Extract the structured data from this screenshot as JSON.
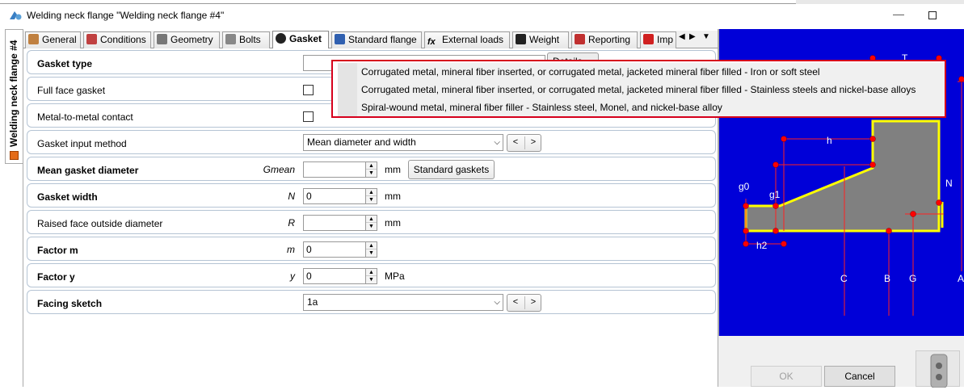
{
  "window": {
    "title": "Welding neck flange \"Welding neck flange #4\"",
    "minimize_glyph": "—"
  },
  "side_tab": {
    "label": "Welding neck flange #4"
  },
  "tabs": [
    {
      "label": "General",
      "icon": "general-icon",
      "color": "#c08040"
    },
    {
      "label": "Conditions",
      "icon": "conditions-icon",
      "color": "#c04040"
    },
    {
      "label": "Geometry",
      "icon": "geometry-icon",
      "color": "#555555"
    },
    {
      "label": "Bolts",
      "icon": "bolts-icon",
      "color": "#666666"
    },
    {
      "label": "Gasket",
      "icon": "gasket-icon",
      "color": "#222222"
    },
    {
      "label": "Standard flange",
      "icon": "book-icon",
      "color": "#3060b0"
    },
    {
      "label": "External loads",
      "icon": "fx-icon",
      "color": "#333333"
    },
    {
      "label": "Weight",
      "icon": "weight-icon",
      "color": "#222222"
    },
    {
      "label": "Reporting",
      "icon": "reporting-icon",
      "color": "#c03030"
    },
    {
      "label": "Imp",
      "icon": "import-icon",
      "color": "#d02020"
    }
  ],
  "tab_nav": {
    "prev": "◀",
    "next": "▶",
    "menu": "▼"
  },
  "form": {
    "gasket_type": {
      "label": "Gasket type",
      "details_button": "Details"
    },
    "full_face_gasket": {
      "label": "Full face gasket"
    },
    "metal_contact": {
      "label": "Metal-to-metal contact"
    },
    "input_method": {
      "label": "Gasket input method",
      "value": "Mean diameter and width"
    },
    "mean_diameter": {
      "label": "Mean gasket diameter",
      "symbol": "Gmean",
      "value": "",
      "unit": "mm",
      "button": "Standard gaskets"
    },
    "gasket_width": {
      "label": "Gasket width",
      "symbol": "N",
      "value": "0",
      "unit": "mm"
    },
    "raised_face": {
      "label": "Raised face outside diameter",
      "symbol": "R",
      "value": "",
      "unit": "mm"
    },
    "factor_m": {
      "label": "Factor m",
      "symbol": "m",
      "value": "0",
      "unit": ""
    },
    "factor_y": {
      "label": "Factor y",
      "symbol": "y",
      "value": "0",
      "unit": "MPa"
    },
    "facing_sketch": {
      "label": "Facing sketch",
      "value": "1a"
    }
  },
  "nav": {
    "prev": "<",
    "next": ">"
  },
  "dropdown_options": [
    "Corrugated metal, mineral fiber inserted, or corrugated metal, jacketed mineral fiber filled - Iron or soft steel",
    "Corrugated metal, mineral fiber inserted, or corrugated metal, jacketed mineral fiber filled - Stainless steels and nickel-base alloys",
    "Spiral-wound metal, mineral fiber filler - Stainless steel, Monel, and nickel-base alloy"
  ],
  "sketch_labels": {
    "t": "T",
    "h": "h",
    "g0": "g0",
    "g1": "g1",
    "n": "N",
    "h2": "h2",
    "c": "C",
    "b": "B",
    "g": "G",
    "a": "A"
  },
  "buttons": {
    "ok": "OK",
    "cancel": "Cancel"
  },
  "colors": {
    "sketch_bg": "#0000d8",
    "flange_fill": "#808080",
    "outline": "#ffff00",
    "dim_line": "#ff0000",
    "dropdown_border": "#d6001c"
  }
}
